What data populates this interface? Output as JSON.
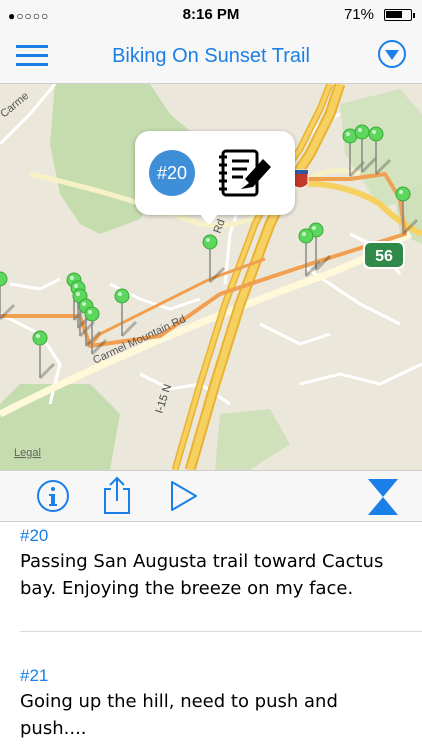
{
  "status_bar": {
    "signal": "●○○○○",
    "time": "8:16 PM",
    "battery": "71%",
    "battery_level": 0.71
  },
  "nav": {
    "title": "Biking On Sunset Trail",
    "menu_icon": "list-icon",
    "filter_icon": "chevron-down-circle-icon"
  },
  "map": {
    "labels": {
      "street1": "Carme",
      "street2": "Carmel Mountain Rd",
      "street3": "Rd",
      "interstate": "I-15 N",
      "shield_15": "15",
      "shield_56": "56",
      "legal": "Legal"
    },
    "callout": {
      "number": "#20",
      "icon": "edit-notes-icon"
    },
    "colors": {
      "route": "#f0a050",
      "pin": "#5cd65c",
      "highway": "#f2c14a",
      "park": "#c5dcae"
    }
  },
  "toolbar": {
    "info_icon": "info-icon",
    "share_icon": "share-icon",
    "play_icon": "play-icon",
    "collapse_icon": "hourglass-icon"
  },
  "entries": [
    {
      "id": "#20",
      "text": "Passing San Augusta trail toward Cactus bay. Enjoying the breeze on my face."
    },
    {
      "id": "#21",
      "text": "Going up the hill, need to push and push...."
    }
  ]
}
